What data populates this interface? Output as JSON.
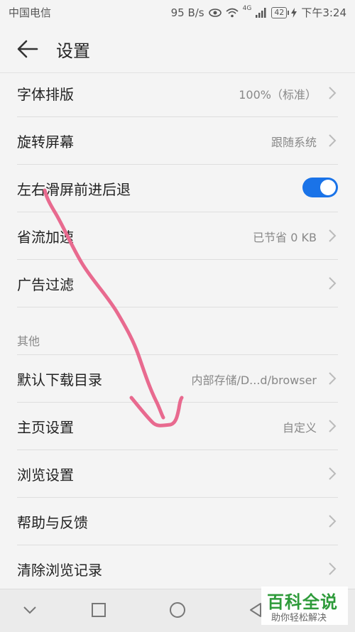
{
  "status_bar": {
    "carrier": "中国电信",
    "speed": "95 B/s",
    "network": "4G",
    "battery": "42",
    "time": "下午3:24"
  },
  "header": {
    "title": "设置"
  },
  "rows": [
    {
      "label": "字体排版",
      "value": "100%（标准）"
    },
    {
      "label": "旋转屏幕",
      "value": "跟随系统"
    },
    {
      "label": "左右滑屏前进后退",
      "toggle": true
    },
    {
      "label": "省流加速",
      "value": "已节省 0 KB"
    },
    {
      "label": "广告过滤",
      "value": ""
    }
  ],
  "section_other": "其他",
  "rows2": [
    {
      "label": "默认下载目录",
      "value": "内部存储/D...d/browser"
    },
    {
      "label": "主页设置",
      "value": "自定义"
    },
    {
      "label": "浏览设置",
      "value": ""
    },
    {
      "label": "帮助与反馈",
      "value": ""
    },
    {
      "label": "清除浏览记录",
      "value": ""
    }
  ],
  "watermark": {
    "title": "百科全说",
    "subtitle": "助你轻松解决"
  },
  "colors": {
    "accent": "#1a73e8",
    "annotation": "#e86a8f",
    "watermark_green": "#2e9b3a"
  }
}
